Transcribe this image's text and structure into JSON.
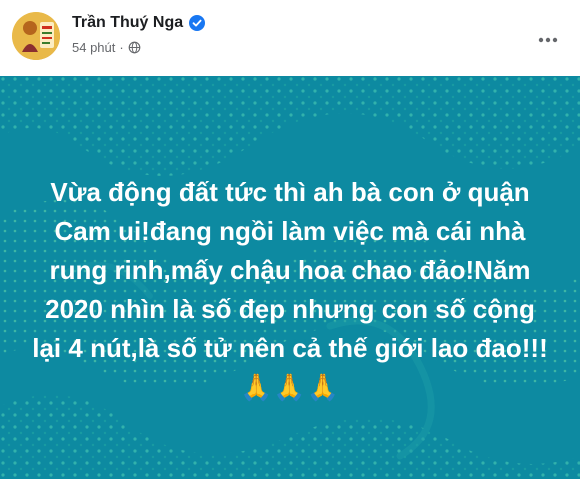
{
  "post": {
    "author": "Trần Thuý Nga",
    "time": "54 phút",
    "separator": "·",
    "verified_icon": "verified-badge-icon",
    "audience_icon": "globe-icon",
    "more_icon": "more-horizontal-icon",
    "text": "Vừa động đất tức thì ah bà con ở quận Cam ui!đang ngồi làm việc mà cái nhà rung rinh,mấy chậu hoa chao đảo!Năm 2020 nhìn là số đẹp nhưng con số cộng lại 4 nút,là số tử nên cả thế giới lao đao!!!",
    "emoji": "🙏🙏🙏",
    "background_color": "#0d8aa1",
    "accent_color": "#1877f2"
  }
}
